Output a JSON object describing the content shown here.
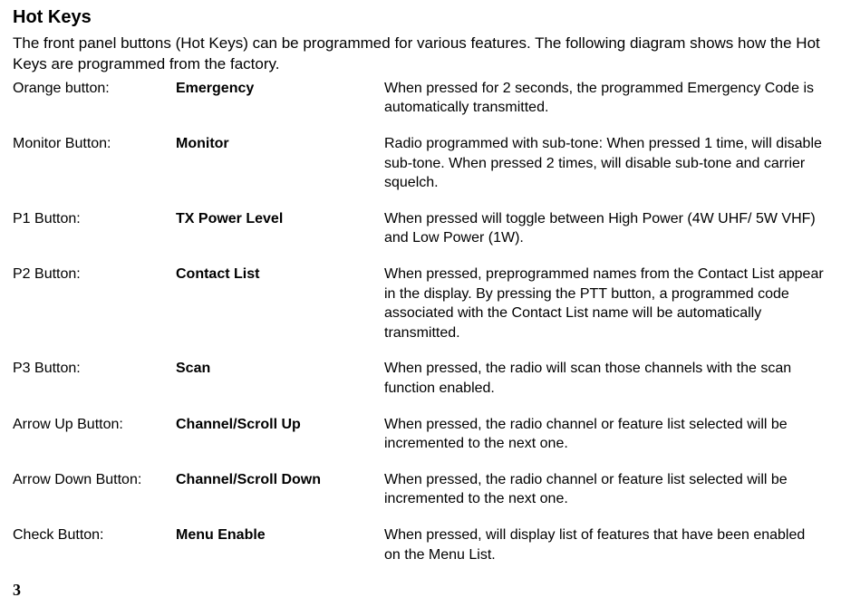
{
  "title": "Hot Keys",
  "intro": "The front panel buttons (Hot Keys) can be programmed for various features.  The following diagram shows how the Hot Keys are programmed from the factory.",
  "rows": [
    {
      "button": "Orange button:",
      "feature": "Emergency",
      "desc": "When pressed for 2 seconds, the programmed Emergency Code is  automatically transmitted."
    },
    {
      "button": "Monitor Button:",
      "feature": "Monitor",
      "desc": "Radio programmed with sub-tone: When pressed 1 time, will disable sub-tone.  When pressed 2 times, will disable sub-tone and carrier   squelch."
    },
    {
      "button": "P1 Button:",
      "feature": "TX Power Level",
      "desc": "When pressed will toggle between High Power (4W UHF/ 5W VHF) and Low Power (1W)."
    },
    {
      "button": "P2 Button:",
      "feature": "Contact List",
      "desc": "When pressed, preprogrammed names from the Contact List appear in the display.  By pressing the PTT button, a programmed code associated with the Contact List name will be automatically transmitted."
    },
    {
      "button": "P3 Button:",
      "feature": "Scan",
      "desc": "When pressed, the radio will scan those channels with the scan function enabled."
    },
    {
      "button": "Arrow Up Button:",
      "feature": "Channel/Scroll Up",
      "desc": "When pressed, the radio channel or feature list selected will be incremented to the next one."
    },
    {
      "button": "Arrow Down Button:",
      "feature": "Channel/Scroll Down",
      "desc": "When pressed, the radio channel or feature list selected will be incremented to the next one."
    },
    {
      "button": "Check Button:",
      "feature": "Menu Enable",
      "desc": "When pressed, will display list of features that have been enabled on the Menu List."
    }
  ],
  "page_number": "3"
}
